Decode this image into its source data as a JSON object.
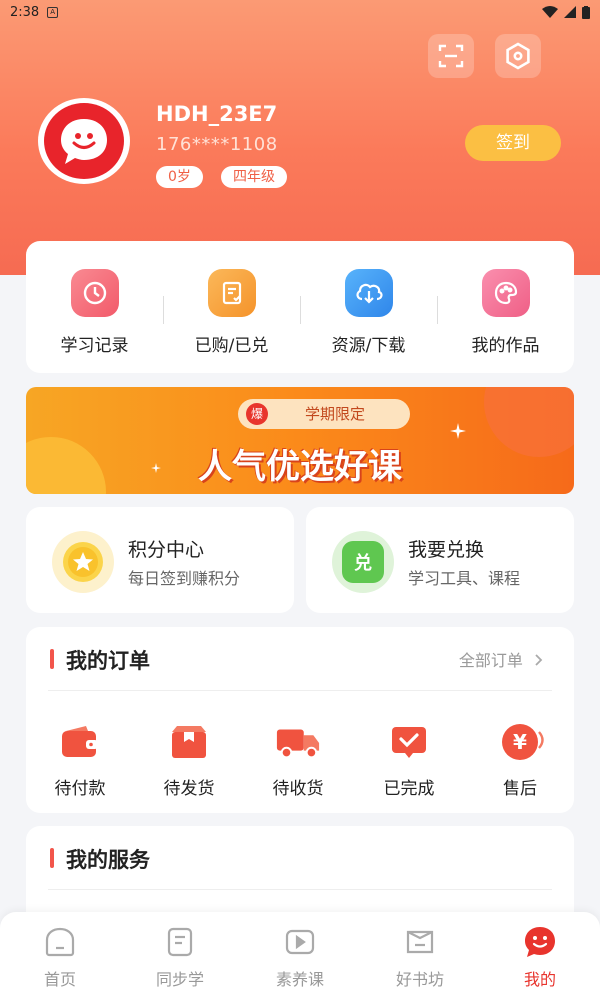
{
  "status": {
    "time": "2:38",
    "sim_label": "A"
  },
  "profile": {
    "username": "HDH_23E7",
    "phone": "176****1108",
    "age_tag": "0岁",
    "grade_tag": "四年级",
    "checkin_label": "签到"
  },
  "icons": {
    "scan": "scan-icon",
    "settings": "hexagon-settings-icon"
  },
  "quick": [
    {
      "label": "学习记录",
      "icon": "clock-icon",
      "color": "#f5737d"
    },
    {
      "label": "已购/已兑",
      "icon": "receipt-icon",
      "color": "#f8a13b"
    },
    {
      "label": "资源/下载",
      "icon": "cloud-download-icon",
      "color": "#3d9cf2"
    },
    {
      "label": "我的作品",
      "icon": "palette-icon",
      "color": "#f16f90"
    }
  ],
  "banner": {
    "ribbon_badge": "爆",
    "ribbon_text": "学期限定",
    "headline": "人气优选好课"
  },
  "mini_cards": [
    {
      "title": "积分中心",
      "subtitle": "每日签到赚积分",
      "icon": "star-coin-icon",
      "color": "#fbcb3d"
    },
    {
      "title": "我要兑换",
      "subtitle": "学习工具、课程",
      "icon": "exchange-icon",
      "color": "#5fc750",
      "glyph": "兑"
    }
  ],
  "orders": {
    "title": "我的订单",
    "all_label": "全部订单",
    "items": [
      {
        "label": "待付款",
        "icon": "wallet-icon"
      },
      {
        "label": "待发货",
        "icon": "package-icon"
      },
      {
        "label": "待收货",
        "icon": "truck-icon"
      },
      {
        "label": "已完成",
        "icon": "check-box-icon"
      },
      {
        "label": "售后",
        "icon": "yen-refund-icon",
        "glyph": "¥"
      }
    ]
  },
  "services": {
    "title": "我的服务"
  },
  "tabs": [
    {
      "label": "首页",
      "icon": "home-icon"
    },
    {
      "label": "同步学",
      "icon": "book-icon"
    },
    {
      "label": "素养课",
      "icon": "video-icon"
    },
    {
      "label": "好书坊",
      "icon": "bookstore-icon"
    },
    {
      "label": "我的",
      "icon": "profile-chat-icon"
    }
  ],
  "colors": {
    "accent": "#f66b52",
    "active_tab": "#e8342d",
    "checkin": "#fbbf43"
  }
}
